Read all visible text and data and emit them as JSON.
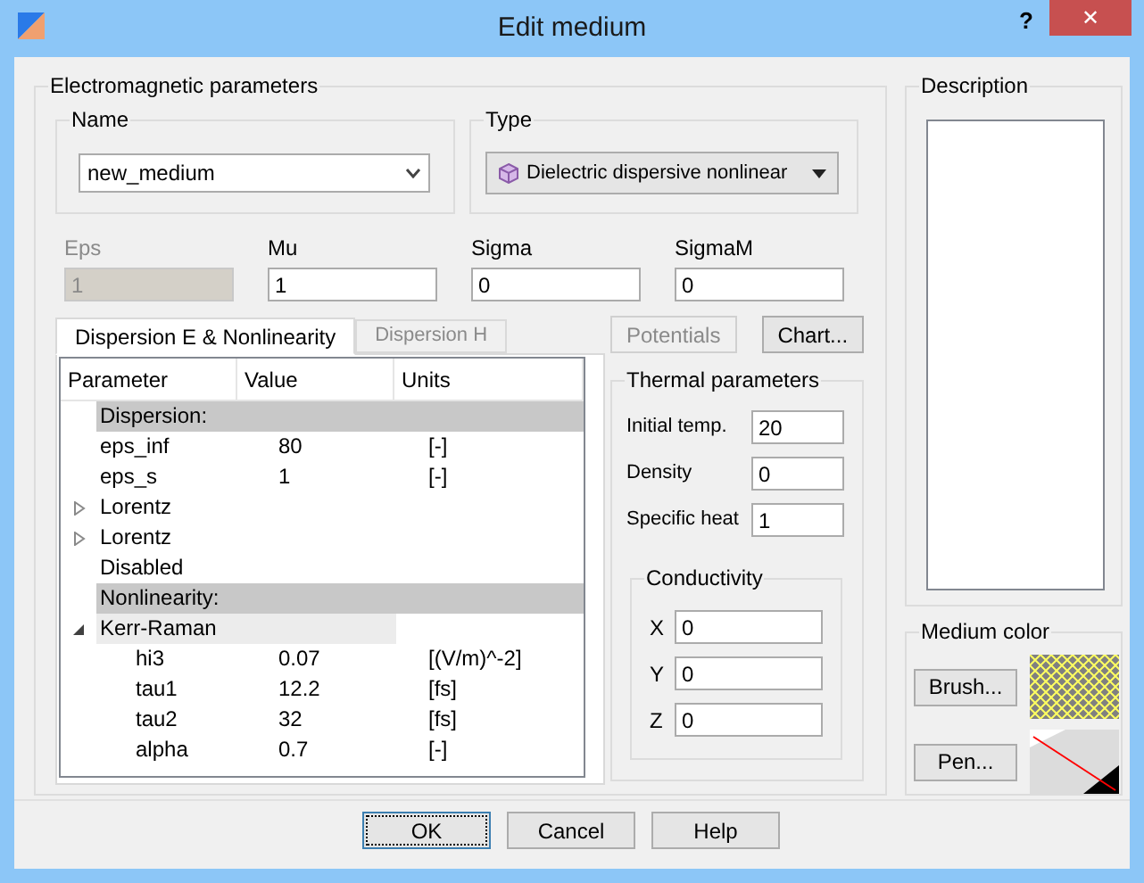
{
  "window": {
    "title": "Edit medium",
    "help": "?",
    "close": "✕"
  },
  "em": {
    "title": "Electromagnetic parameters",
    "name": {
      "label": "Name",
      "value": "new_medium"
    },
    "type": {
      "label": "Type",
      "value": "Dielectric dispersive nonlinear"
    },
    "fields": [
      {
        "label": "Eps",
        "value": "1",
        "disabled": true
      },
      {
        "label": "Mu",
        "value": "1",
        "disabled": false
      },
      {
        "label": "Sigma",
        "value": "0",
        "disabled": false
      },
      {
        "label": "SigmaM",
        "value": "0",
        "disabled": false
      }
    ],
    "tabs": [
      {
        "label": "Dispersion E & Nonlinearity",
        "selected": true
      },
      {
        "label": "Dispersion H",
        "selected": false
      }
    ],
    "tree": {
      "columns": [
        "Parameter",
        "Value",
        "Units"
      ],
      "rows": [
        {
          "kind": "section",
          "label": "Dispersion:"
        },
        {
          "kind": "param",
          "parameter": "eps_inf",
          "value": "80",
          "units": "[-]"
        },
        {
          "kind": "param",
          "parameter": "eps_s",
          "value": "1",
          "units": "[-]"
        },
        {
          "kind": "group",
          "label": "Lorentz",
          "expanded": false,
          "selected": false
        },
        {
          "kind": "group",
          "label": "Lorentz",
          "expanded": false,
          "selected": false
        },
        {
          "kind": "param",
          "parameter": "Disabled"
        },
        {
          "kind": "section",
          "label": "Nonlinearity:"
        },
        {
          "kind": "group",
          "label": "Kerr-Raman",
          "expanded": true,
          "selected": true,
          "children": [
            {
              "kind": "param",
              "parameter": "hi3",
              "value": "0.07",
              "units": "[(V/m)^-2]"
            },
            {
              "kind": "param",
              "parameter": "tau1",
              "value": "12.2",
              "units": "[fs]"
            },
            {
              "kind": "param",
              "parameter": "tau2",
              "value": "32",
              "units": "[fs]"
            },
            {
              "kind": "param",
              "parameter": "alpha",
              "value": "0.7",
              "units": "[-]"
            }
          ]
        }
      ]
    },
    "side_buttons": [
      {
        "label": "Potentials",
        "disabled": true
      },
      {
        "label": "Chart...",
        "disabled": false
      }
    ],
    "thermal": {
      "title": "Thermal parameters",
      "fields": [
        {
          "label": "Initial temp.",
          "value": "20"
        },
        {
          "label": "Density",
          "value": "0"
        },
        {
          "label": "Specific heat",
          "value": "1"
        }
      ],
      "conductivity": {
        "title": "Conductivity",
        "fields": [
          {
            "label": "X",
            "value": "0"
          },
          {
            "label": "Y",
            "value": "0"
          },
          {
            "label": "Z",
            "value": "0"
          }
        ]
      }
    }
  },
  "description": {
    "title": "Description"
  },
  "medium_color": {
    "title": "Medium color",
    "buttons": [
      "Brush...",
      "Pen..."
    ]
  },
  "buttons": [
    {
      "label": "OK",
      "default": true
    },
    {
      "label": "Cancel",
      "default": false
    },
    {
      "label": "Help",
      "default": false
    }
  ]
}
